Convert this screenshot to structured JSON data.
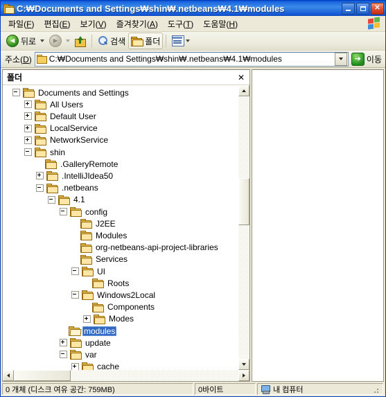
{
  "window": {
    "title": "C:\\Documents and Settings\\shin\\.netbeans\\4.1\\modules",
    "title_display": "C:₩Documents and Settings₩shin₩.netbeans₩4.1₩modules",
    "icon": "folder-icon",
    "buttons": {
      "minimize": "_",
      "maximize": "□",
      "close": "✕"
    }
  },
  "menu": {
    "items": [
      {
        "label": "파일",
        "accel": "F"
      },
      {
        "label": "편집",
        "accel": "E"
      },
      {
        "label": "보기",
        "accel": "V"
      },
      {
        "label": "즐겨찾기",
        "accel": "A"
      },
      {
        "label": "도구",
        "accel": "T"
      },
      {
        "label": "도움말",
        "accel": "H"
      }
    ],
    "logo": "windows-flag-logo"
  },
  "toolbar": {
    "back_label": "뒤로",
    "forward_label": "",
    "up_label": "",
    "search_label": "검색",
    "folders_label": "폴더",
    "views_label": ""
  },
  "address": {
    "label": "주소",
    "accel": "D",
    "value": "C:₩Documents and Settings₩shin₩.netbeans₩4.1₩modules",
    "go_label": "이동",
    "go_glyph": "➜"
  },
  "folders_pane": {
    "title": "폴더",
    "close_glyph": "✕",
    "tree": [
      {
        "label": "Documents and Settings",
        "depth": 0,
        "state": "minus",
        "icon": "folder-icon"
      },
      {
        "label": "All Users",
        "depth": 1,
        "state": "plus",
        "icon": "folder-icon"
      },
      {
        "label": "Default User",
        "depth": 1,
        "state": "plus",
        "icon": "folder-icon"
      },
      {
        "label": "LocalService",
        "depth": 1,
        "state": "plus",
        "icon": "folder-icon"
      },
      {
        "label": "NetworkService",
        "depth": 1,
        "state": "plus",
        "icon": "folder-icon"
      },
      {
        "label": "shin",
        "depth": 1,
        "state": "minus",
        "icon": "folder-icon"
      },
      {
        "label": ".GalleryRemote",
        "depth": 2,
        "state": "none",
        "icon": "folder-icon"
      },
      {
        "label": ".IntelliJIdea50",
        "depth": 2,
        "state": "plus",
        "icon": "folder-icon"
      },
      {
        "label": ".netbeans",
        "depth": 2,
        "state": "minus",
        "icon": "folder-icon"
      },
      {
        "label": "4.1",
        "depth": 3,
        "state": "minus",
        "icon": "folder-icon"
      },
      {
        "label": "config",
        "depth": 4,
        "state": "minus",
        "icon": "folder-icon"
      },
      {
        "label": "J2EE",
        "depth": 5,
        "state": "none",
        "icon": "folder-icon"
      },
      {
        "label": "Modules",
        "depth": 5,
        "state": "none",
        "icon": "folder-icon"
      },
      {
        "label": "org-netbeans-api-project-libraries",
        "depth": 5,
        "state": "none",
        "icon": "folder-icon"
      },
      {
        "label": "Services",
        "depth": 5,
        "state": "none",
        "icon": "folder-icon"
      },
      {
        "label": "UI",
        "depth": 5,
        "state": "minus",
        "icon": "folder-icon"
      },
      {
        "label": "Roots",
        "depth": 6,
        "state": "none",
        "icon": "folder-icon"
      },
      {
        "label": "Windows2Local",
        "depth": 5,
        "state": "minus",
        "icon": "folder-icon"
      },
      {
        "label": "Components",
        "depth": 6,
        "state": "none",
        "icon": "folder-icon"
      },
      {
        "label": "Modes",
        "depth": 6,
        "state": "plus",
        "icon": "folder-icon"
      },
      {
        "label": "modules",
        "depth": 4,
        "state": "none",
        "icon": "open-folder-icon",
        "selected": true
      },
      {
        "label": "update",
        "depth": 4,
        "state": "plus",
        "icon": "folder-icon"
      },
      {
        "label": "var",
        "depth": 4,
        "state": "minus",
        "icon": "folder-icon"
      },
      {
        "label": "cache",
        "depth": 5,
        "state": "plus",
        "icon": "folder-icon"
      }
    ]
  },
  "status": {
    "items": "0 개체 (디스크 여유 공간: 759MB)",
    "size": "0바이트",
    "location": "내 컴퓨터"
  },
  "colors": {
    "selection": "#316ac5",
    "titlebar": "#1d66e0",
    "chrome": "#ece9d8"
  }
}
